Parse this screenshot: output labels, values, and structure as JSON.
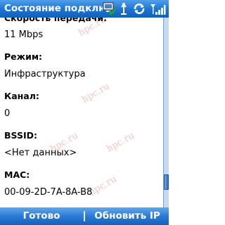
{
  "titlebar": {
    "title": "Состояние подключ",
    "icons": [
      "network-icon",
      "antenna-icon",
      "sync-icon",
      "signal-icon"
    ]
  },
  "fields": {
    "speed": {
      "label": "Скорость передачи:",
      "value": "11 Mbps"
    },
    "mode": {
      "label": "Режим:",
      "value": "Инфраструктура"
    },
    "channel": {
      "label": "Канал:",
      "value": "0"
    },
    "bssid": {
      "label": "BSSID:",
      "value": "<Нет данных>"
    },
    "mac": {
      "label": "MAC:",
      "value": "00-09-2D-7A-8A-B8"
    }
  },
  "softkeys": {
    "left": "Готово",
    "right": "Обновить IP"
  },
  "watermark": "hpc.ru",
  "scroll_position": 0.9,
  "colors": {
    "titlebar": "#1d73d2",
    "softbar": "#2b7bd6",
    "watermark": "#f4c6c6"
  }
}
